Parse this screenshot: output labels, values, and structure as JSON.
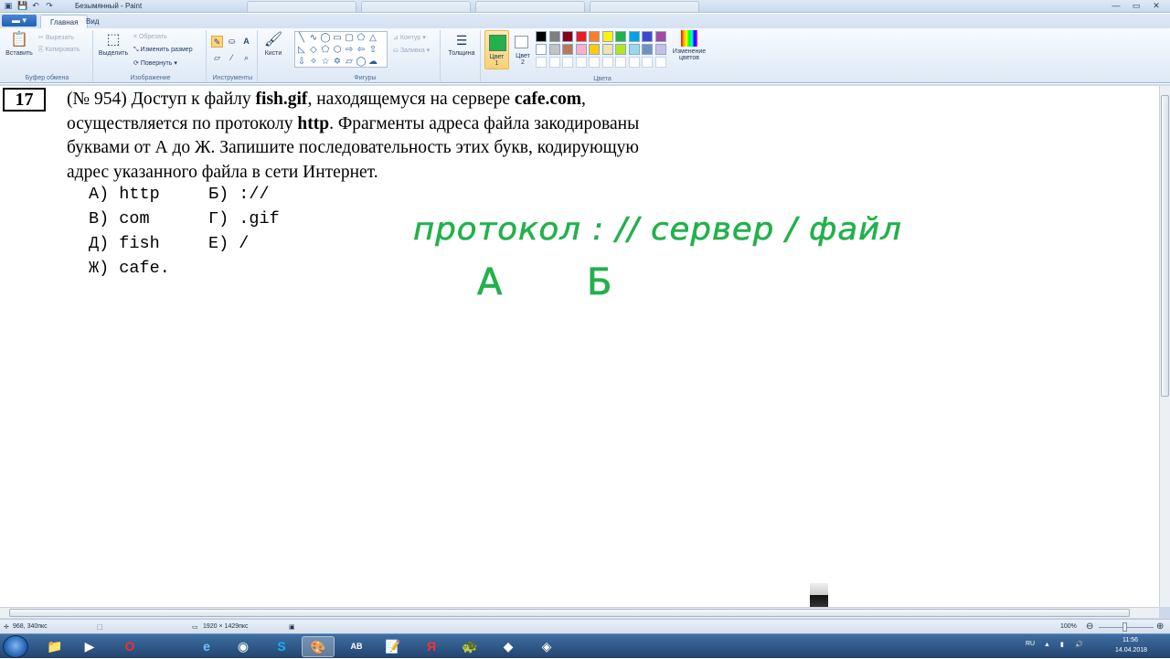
{
  "window": {
    "title": "Безымянный - Paint",
    "qa_icons": [
      "paint-icon",
      "save-icon",
      "undo-icon",
      "redo-icon"
    ],
    "controls": [
      "—",
      "▭",
      "✕"
    ]
  },
  "ribbon_tabs": {
    "app_menu": "▬ ▾",
    "tabs": [
      "Главная",
      "Вид"
    ]
  },
  "ribbon": {
    "clipboard": {
      "paste": "Вставить",
      "cut": "Вырезать",
      "copy": "Копировать",
      "label": "Буфер обмена"
    },
    "image": {
      "select": "Выделить",
      "crop": "Обрезать",
      "resize": "Изменить размер",
      "rotate": "Повернуть ▾",
      "label": "Изображение"
    },
    "tools": {
      "label": "Инструменты"
    },
    "brushes": {
      "label": "Кисти"
    },
    "shapes": {
      "outline": "Контур ▾",
      "fill": "Заливка ▾",
      "label": "Фигуры"
    },
    "size": {
      "label": "Толщина"
    },
    "color1": {
      "label": "Цвет",
      "num": "1",
      "value": "#22b14c"
    },
    "color2": {
      "label": "Цвет",
      "num": "2",
      "value": "#ffffff"
    },
    "colors": {
      "label": "Цвета",
      "edit": "Изменение цветов"
    },
    "palette_row1": [
      "#000000",
      "#7f7f7f",
      "#880015",
      "#ed1c24",
      "#ff7f27",
      "#fff200",
      "#22b14c",
      "#00a2e8",
      "#3f48cc",
      "#a349a4"
    ],
    "palette_row2": [
      "#ffffff",
      "#c3c3c3",
      "#b97a57",
      "#ffaec9",
      "#ffc90e",
      "#efe4b0",
      "#b5e61d",
      "#99d9ea",
      "#7092be",
      "#c8bfe7"
    ]
  },
  "canvas": {
    "task_number": "17",
    "task_lines": [
      [
        {
          "t": "(№ 954) Доступ к файлу ",
          "b": false
        },
        {
          "t": "fish.gif",
          "b": true
        },
        {
          "t": ", находящемуся на сервере ",
          "b": false
        },
        {
          "t": "cafe.com",
          "b": true
        },
        {
          "t": ",",
          "b": false
        }
      ],
      [
        {
          "t": "осуществляется по протоколу ",
          "b": false
        },
        {
          "t": "http",
          "b": true
        },
        {
          "t": ". Фрагменты адреса файла закодированы",
          "b": false
        }
      ],
      [
        {
          "t": "буквами от А до Ж. Запишите последовательность этих букв, кодирующую",
          "b": false
        }
      ],
      [
        {
          "t": "адрес указанного файла в сети Интернет.",
          "b": false
        }
      ]
    ],
    "options": [
      "А) http",
      "Б) ://",
      "В) com",
      "Г) .gif",
      "Д) fish",
      "Е) /",
      "Ж) cafe."
    ],
    "handwriting": {
      "line1": "протокол : // сервер / файл",
      "line2_a": "А",
      "line2_b": "Б",
      "ink_color": "#22b14c"
    }
  },
  "statusbar": {
    "cursor": "968, 340пкс",
    "dimensions": "1920 × 1429пкс",
    "zoom": "100%",
    "zoom_minus": "⊖",
    "zoom_plus": "⊕"
  },
  "taskbar": {
    "apps": [
      "explorer",
      "media-player",
      "opera",
      "ie",
      "chrome",
      "skype",
      "paint-brush",
      "abbyy",
      "word-doc",
      "yandex",
      "turtle",
      "game",
      "game2"
    ],
    "lang": "RU",
    "time": "11:56",
    "date": "14.04.2018"
  }
}
